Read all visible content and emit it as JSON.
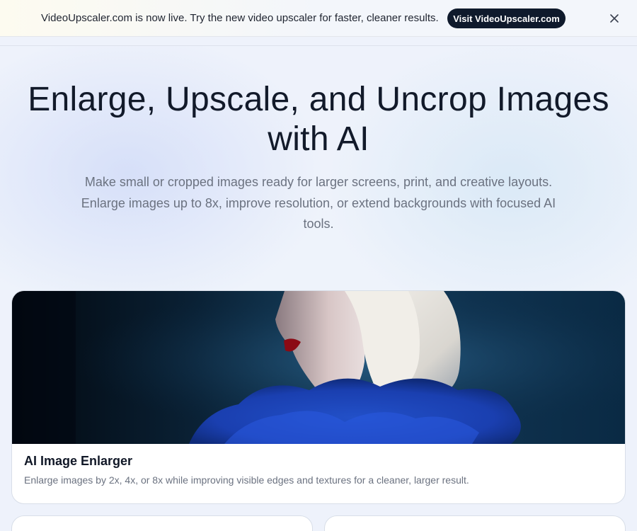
{
  "banner": {
    "text": "VideoUpscaler.com is now live. Try the new video upscaler for faster, cleaner results.",
    "button_label": "Visit VideoUpscaler.com",
    "close_icon": "close-icon"
  },
  "hero": {
    "title": "Enlarge, Upscale, and Uncrop Images with AI",
    "subtitle": "Make small or cropped images ready for larger screens, print, and creative layouts. Enlarge images up to 8x, improve resolution, or extend backgrounds with focused AI tools."
  },
  "cards": [
    {
      "title": "AI Image Enlarger",
      "description": "Enlarge images by 2x, 4x, or 8x while improving visible edges and textures for a cleaner, larger result.",
      "image_alt": "portrait of woman with platinum bob and blue ruffled collar"
    }
  ],
  "colors": {
    "banner_button_bg": "#0f1a2c",
    "hero_title": "#121a2a",
    "hero_subtitle": "#6b7280",
    "card_border": "#d8dee8"
  }
}
